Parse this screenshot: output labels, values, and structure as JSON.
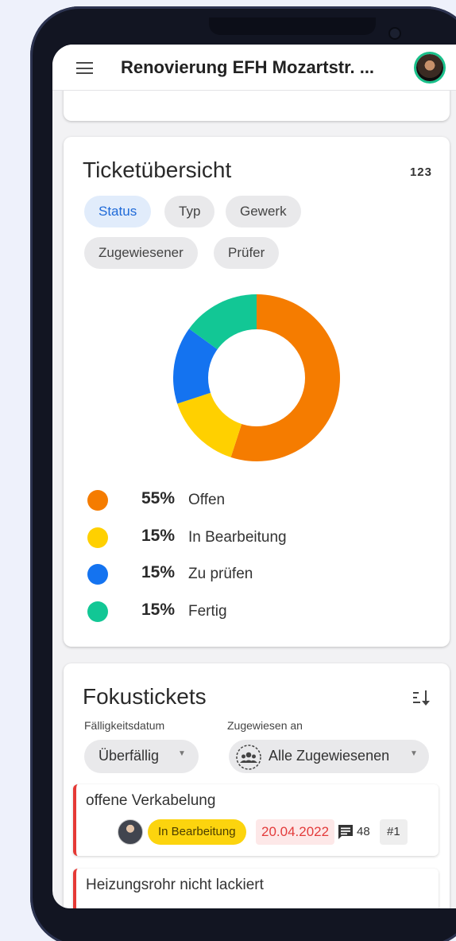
{
  "app": {
    "title": "Renovierung EFH Mozartstr. ..."
  },
  "overview": {
    "title": "Ticketübersicht",
    "count_label": "123",
    "filters": [
      {
        "label": "Status",
        "active": true
      },
      {
        "label": "Typ",
        "active": false
      },
      {
        "label": "Gewerk",
        "active": false
      },
      {
        "label": "Zugewiesener",
        "active": false
      },
      {
        "label": "Prüfer",
        "active": false
      }
    ],
    "chart_data": {
      "type": "pie",
      "categories": [
        "Offen",
        "In Bearbeitung",
        "Zu prüfen",
        "Fertig"
      ],
      "values": [
        55,
        15,
        15,
        15
      ],
      "colors": [
        "#f57c00",
        "#ffd000",
        "#1473f0",
        "#12c795"
      ]
    },
    "legend": [
      {
        "pct": "55%",
        "label": "Offen",
        "color": "#f57c00"
      },
      {
        "pct": "15%",
        "label": "In Bearbeitung",
        "color": "#ffd000"
      },
      {
        "pct": "15%",
        "label": "Zu prüfen",
        "color": "#1473f0"
      },
      {
        "pct": "15%",
        "label": "Fertig",
        "color": "#12c795"
      }
    ]
  },
  "focus": {
    "title": "Fokustickets",
    "sort_icon": "sort-icon",
    "due_label": "Fälligkeitsdatum",
    "due_value": "Überfällig",
    "assigned_label": "Zugewiesen an",
    "assigned_value": "Alle Zugewiesenen",
    "tickets": [
      {
        "title": "offene Verkabelung",
        "status": "In Bearbeitung",
        "date": "20.04.2022",
        "comments": "48",
        "number": "#1"
      },
      {
        "title": "Heizungsrohr nicht lackiert"
      }
    ]
  },
  "colors": {
    "accent": "#1f6ad8",
    "overdue": "#e53935",
    "status_in_progress": "#fcd40e"
  }
}
